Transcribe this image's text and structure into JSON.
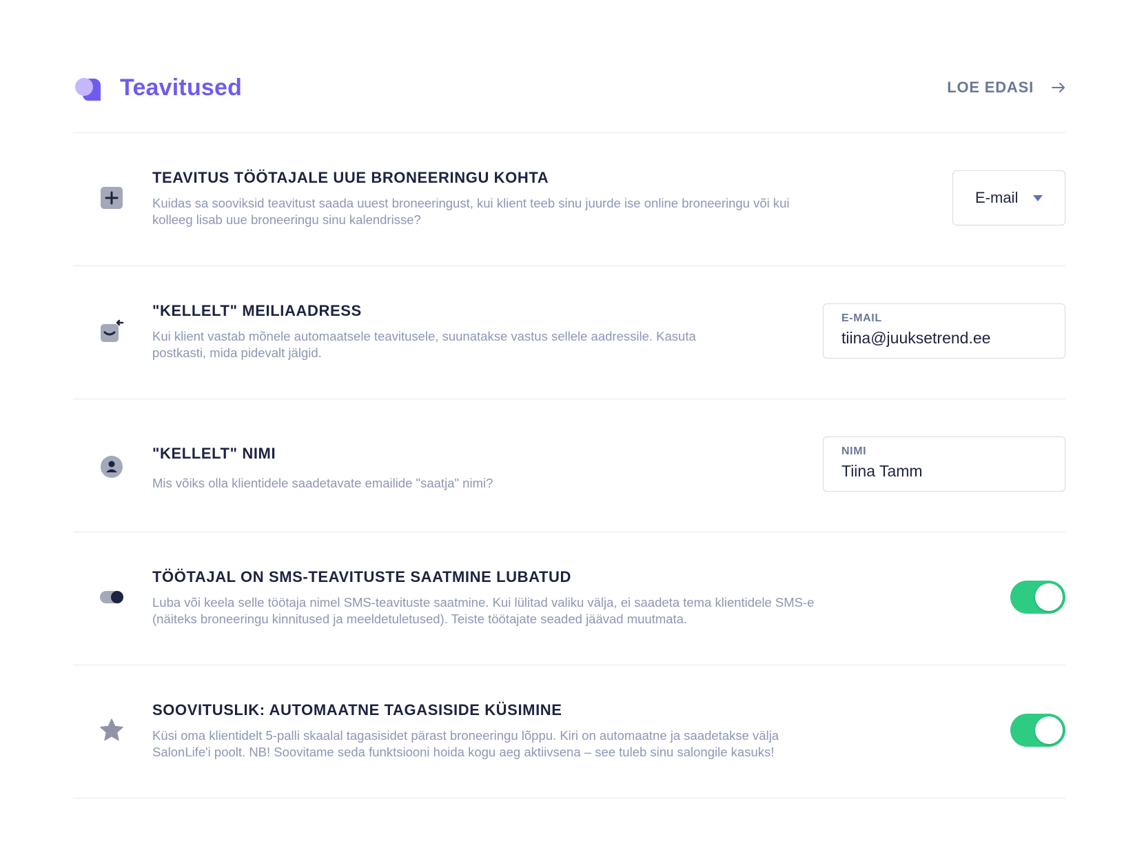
{
  "header": {
    "title": "Teavitused",
    "read_more": "LOE EDASI",
    "logo_icon": "chat-bubbles-icon",
    "arrow_icon": "arrow-right-icon"
  },
  "settings": [
    {
      "icon": "plus-square-icon",
      "heading": "TEAVITUS TÖÖTAJALE UUE BRONEERINGU KOHTA",
      "description_line1": "Kuidas sa sooviksid teavitust saada uuest broneeringust, kui klient teeb sinu juurde ise online broneeringu või kui",
      "description_line2": "kolleeg lisab uue broneeringu sinu kalendrisse?",
      "control": "select",
      "selected": "E-mail"
    },
    {
      "icon": "mail-reply-icon",
      "heading": "\"KELLELT\" MEILIAADRESS",
      "description_line1": "Kui klient vastab mõnele automaatsele teavitusele, suunatakse vastus sellele aadressile. Kasuta",
      "description_line2": "postkasti, mida pidevalt jälgid.",
      "control": "input",
      "field_label": "E-MAIL",
      "value": "tiina@juuksetrend.ee"
    },
    {
      "icon": "user-icon",
      "heading": "\"KELLELT\" NIMI",
      "description_line1": "Mis võiks olla klientidele saadetavate emailide \"saatja\" nimi?",
      "description_line2": "",
      "control": "input",
      "field_label": "NIMI",
      "value": "Tiina Tamm"
    },
    {
      "icon": "toggle-icon",
      "heading": "TÖÖTAJAL ON SMS-TEAVITUSTE SAATMINE LUBATUD",
      "description_line1": "Luba või keela selle töötaja nimel SMS-teavituste saatmine. Kui lülitad valiku välja, ei saadeta tema klientidele SMS-e",
      "description_line2": "(näiteks broneeringu kinnitused ja meeldetuletused). Teiste töötajate seaded jäävad muutmata.",
      "control": "toggle",
      "enabled": true
    },
    {
      "icon": "star-icon",
      "heading": "SOOVITUSLIK: AUTOMAATNE TAGASISIDE KÜSIMINE",
      "description_line1": "Küsi oma klientidelt 5-palli skaalal tagasisidet pärast broneeringu lõppu. Kiri on automaatne ja saadetakse välja",
      "description_line2": "SalonLife'i poolt. NB! Soovitame seda funktsiooni hoida kogu aeg aktiivsena – see tuleb sinu salongile kasuks!",
      "control": "toggle",
      "enabled": true
    }
  ],
  "colors": {
    "accent": "#6e5cf0",
    "toggle_on": "#2ecc82",
    "heading": "#1d2340",
    "muted": "#8d97b4"
  }
}
